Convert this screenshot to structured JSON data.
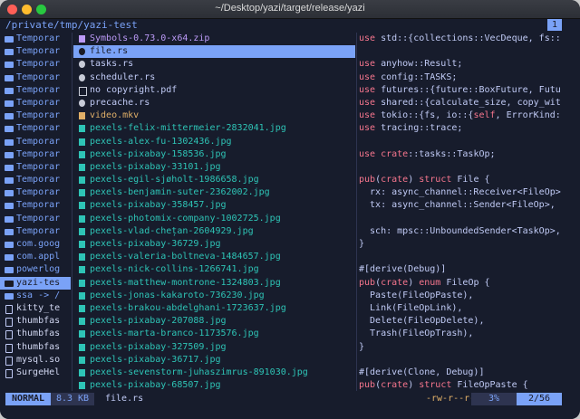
{
  "window": {
    "title": "~/Desktop/yazi/target/release/yazi"
  },
  "header": {
    "cwd": "/private/tmp/yazi-test",
    "tab": "1"
  },
  "parent": [
    {
      "label": "Temporar",
      "icon": "folder-icon"
    },
    {
      "label": "Temporar",
      "icon": "folder-icon"
    },
    {
      "label": "Temporar",
      "icon": "folder-icon"
    },
    {
      "label": "Temporar",
      "icon": "folder-icon"
    },
    {
      "label": "Temporar",
      "icon": "folder-icon"
    },
    {
      "label": "Temporar",
      "icon": "folder-icon"
    },
    {
      "label": "Temporar",
      "icon": "folder-icon"
    },
    {
      "label": "Temporar",
      "icon": "folder-icon"
    },
    {
      "label": "Temporar",
      "icon": "folder-icon"
    },
    {
      "label": "Temporar",
      "icon": "folder-icon"
    },
    {
      "label": "Temporar",
      "icon": "folder-icon"
    },
    {
      "label": "Temporar",
      "icon": "folder-icon"
    },
    {
      "label": "Temporar",
      "icon": "folder-icon"
    },
    {
      "label": "Temporar",
      "icon": "folder-icon"
    },
    {
      "label": "Temporar",
      "icon": "folder-icon"
    },
    {
      "label": "Temporar",
      "icon": "folder-icon"
    },
    {
      "label": "com.goog",
      "icon": "folder-icon"
    },
    {
      "label": "com.appl",
      "icon": "folder-icon"
    },
    {
      "label": "powerlog",
      "icon": "folder-icon"
    },
    {
      "label": "yazi-tes",
      "icon": "folder-icon",
      "selected": true
    },
    {
      "label": "ssa -> /",
      "icon": "folder-icon"
    },
    {
      "label": "kitty_te",
      "icon": "file-icon",
      "plain": true
    },
    {
      "label": "thumbfas",
      "icon": "file-icon",
      "plain": true
    },
    {
      "label": "thumbfas",
      "icon": "file-icon",
      "plain": true
    },
    {
      "label": "thumbfas",
      "icon": "file-icon",
      "plain": true
    },
    {
      "label": "mysql.so",
      "icon": "file-icon",
      "plain": true
    },
    {
      "label": "SurgeHel",
      "icon": "file-icon",
      "plain": true
    }
  ],
  "files": [
    {
      "name": "Symbols-0.73.0-x64.zip",
      "kind": "zip",
      "icon": "archive-icon"
    },
    {
      "name": "file.rs",
      "kind": "rs",
      "icon": "rust-file-icon",
      "current": true
    },
    {
      "name": "tasks.rs",
      "kind": "rs",
      "icon": "rust-file-icon"
    },
    {
      "name": "scheduler.rs",
      "kind": "rs",
      "icon": "rust-file-icon"
    },
    {
      "name": "no copyright.pdf",
      "kind": "pdf",
      "icon": "pdf-file-icon"
    },
    {
      "name": "precache.rs",
      "kind": "rs",
      "icon": "rust-file-icon"
    },
    {
      "name": "video.mkv",
      "kind": "mkv",
      "icon": "video-file-icon"
    },
    {
      "name": "pexels-felix-mittermeier-2832041.jpg",
      "kind": "img",
      "icon": "image-file-icon"
    },
    {
      "name": "pexels-alex-fu-1302436.jpg",
      "kind": "img",
      "icon": "image-file-icon"
    },
    {
      "name": "pexels-pixabay-158536.jpg",
      "kind": "img",
      "icon": "image-file-icon"
    },
    {
      "name": "pexels-pixabay-33101.jpg",
      "kind": "img",
      "icon": "image-file-icon"
    },
    {
      "name": "pexels-egil-sjøholt-1986658.jpg",
      "kind": "img",
      "icon": "image-file-icon"
    },
    {
      "name": "pexels-benjamin-suter-2362002.jpg",
      "kind": "img",
      "icon": "image-file-icon"
    },
    {
      "name": "pexels-pixabay-358457.jpg",
      "kind": "img",
      "icon": "image-file-icon"
    },
    {
      "name": "pexels-photomix-company-1002725.jpg",
      "kind": "img",
      "icon": "image-file-icon"
    },
    {
      "name": "pexels-vlad-chețan-2604929.jpg",
      "kind": "img",
      "icon": "image-file-icon"
    },
    {
      "name": "pexels-pixabay-36729.jpg",
      "kind": "img",
      "icon": "image-file-icon"
    },
    {
      "name": "pexels-valeria-boltneva-1484657.jpg",
      "kind": "img",
      "icon": "image-file-icon"
    },
    {
      "name": "pexels-nick-collins-1266741.jpg",
      "kind": "img",
      "icon": "image-file-icon"
    },
    {
      "name": "pexels-matthew-montrone-1324803.jpg",
      "kind": "img",
      "icon": "image-file-icon"
    },
    {
      "name": "pexels-jonas-kakaroto-736230.jpg",
      "kind": "img",
      "icon": "image-file-icon"
    },
    {
      "name": "pexels-brakou-abdelghani-1723637.jpg",
      "kind": "img",
      "icon": "image-file-icon"
    },
    {
      "name": "pexels-pixabay-207088.jpg",
      "kind": "img",
      "icon": "image-file-icon"
    },
    {
      "name": "pexels-marta-branco-1173576.jpg",
      "kind": "img",
      "icon": "image-file-icon"
    },
    {
      "name": "pexels-pixabay-327509.jpg",
      "kind": "img",
      "icon": "image-file-icon"
    },
    {
      "name": "pexels-pixabay-36717.jpg",
      "kind": "img",
      "icon": "image-file-icon"
    },
    {
      "name": "pexels-sevenstorm-juhaszimrus-891030.jpg",
      "kind": "img",
      "icon": "image-file-icon"
    },
    {
      "name": "pexels-pixabay-68507.jpg",
      "kind": "img",
      "icon": "image-file-icon"
    }
  ],
  "preview": [
    [
      {
        "t": "use",
        "c": "#f7768e"
      },
      {
        "t": " std::{collections::VecDeque, fs::"
      }
    ],
    [
      {
        "t": ""
      }
    ],
    [
      {
        "t": "use",
        "c": "#f7768e"
      },
      {
        "t": " anyhow::Result;"
      }
    ],
    [
      {
        "t": "use",
        "c": "#f7768e"
      },
      {
        "t": " config::TASKS;"
      }
    ],
    [
      {
        "t": "use",
        "c": "#f7768e"
      },
      {
        "t": " futures::{future::BoxFuture, Futu"
      }
    ],
    [
      {
        "t": "use",
        "c": "#f7768e"
      },
      {
        "t": " shared::{calculate_size, copy_wit"
      }
    ],
    [
      {
        "t": "use",
        "c": "#f7768e"
      },
      {
        "t": " tokio::{fs, io::{"
      },
      {
        "t": "self",
        "c": "#f7768e"
      },
      {
        "t": ", ErrorKind:"
      }
    ],
    [
      {
        "t": "use",
        "c": "#f7768e"
      },
      {
        "t": " tracing::trace;"
      }
    ],
    [
      {
        "t": ""
      }
    ],
    [
      {
        "t": "use",
        "c": "#f7768e"
      },
      {
        "t": " "
      },
      {
        "t": "crate",
        "c": "#f7768e"
      },
      {
        "t": "::tasks::TaskOp;"
      }
    ],
    [
      {
        "t": ""
      }
    ],
    [
      {
        "t": "pub",
        "c": "#f7768e"
      },
      {
        "t": "("
      },
      {
        "t": "crate",
        "c": "#f7768e"
      },
      {
        "t": ") "
      },
      {
        "t": "struct",
        "c": "#f7768e"
      },
      {
        "t": " File {"
      }
    ],
    [
      {
        "t": "  rx: async_channel::Receiver<FileOp>"
      }
    ],
    [
      {
        "t": "  tx: async_channel::Sender<FileOp>,"
      }
    ],
    [
      {
        "t": ""
      }
    ],
    [
      {
        "t": "  sch: mpsc::UnboundedSender<TaskOp>,"
      }
    ],
    [
      {
        "t": "}"
      }
    ],
    [
      {
        "t": ""
      }
    ],
    [
      {
        "t": "#[derive(Debug)]"
      }
    ],
    [
      {
        "t": "pub",
        "c": "#f7768e"
      },
      {
        "t": "("
      },
      {
        "t": "crate",
        "c": "#f7768e"
      },
      {
        "t": ") "
      },
      {
        "t": "enum",
        "c": "#f7768e"
      },
      {
        "t": " FileOp {"
      }
    ],
    [
      {
        "t": "  Paste(FileOpPaste),"
      }
    ],
    [
      {
        "t": "  Link(FileOpLink),"
      }
    ],
    [
      {
        "t": "  Delete(FileOpDelete),"
      }
    ],
    [
      {
        "t": "  Trash(FileOpTrash),"
      }
    ],
    [
      {
        "t": "}"
      }
    ],
    [
      {
        "t": ""
      }
    ],
    [
      {
        "t": "#[derive(Clone, Debug)]"
      }
    ],
    [
      {
        "t": "pub",
        "c": "#f7768e"
      },
      {
        "t": "("
      },
      {
        "t": "crate",
        "c": "#f7768e"
      },
      {
        "t": ") "
      },
      {
        "t": "struct",
        "c": "#f7768e"
      },
      {
        "t": " FileOpPaste {"
      }
    ]
  ],
  "status": {
    "mode": "NORMAL",
    "size": "8.3 KB",
    "filename": "file.rs",
    "permissions": "-rw-r--r--",
    "percent": "3%",
    "position": "2/56"
  },
  "colors": {
    "accent": "#7aa2f7",
    "background": "#171c2c",
    "image": "#2ec4b6",
    "keyword": "#f7768e"
  }
}
